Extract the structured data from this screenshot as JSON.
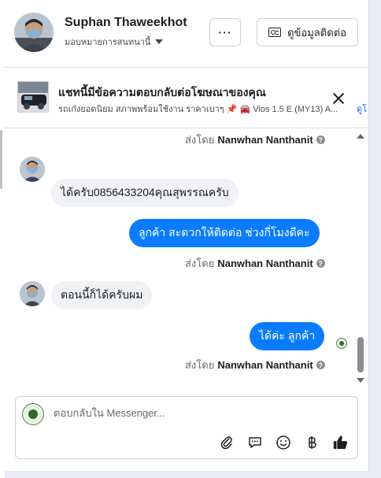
{
  "header": {
    "contact_name": "Suphan Thaweekhot",
    "assign_label": "มอบหมายการสนทนานี้",
    "more_label": "···",
    "contact_info_label": "ดูข้อมูลติดต่อ"
  },
  "ad": {
    "title": "แชทนี้มีข้อความตอบกลับต่อโฆษณาของคุณ",
    "subtitle": "รถเก๋งยอดนิยม สภาพพร้อมใช้งาน ราคาเบาๆ 📌 🚘 Vios 1.5 E (MY13) A...",
    "more_link": "ดูโ"
  },
  "messages": [
    {
      "type": "sent_by",
      "prefix": "ส่งโดย",
      "name": "Nanwhan Nanthanit"
    },
    {
      "type": "incoming",
      "text": "ได้ครับ0856433204คุณสุพรรณครับ"
    },
    {
      "type": "outgoing",
      "text": "ลูกค้า สะดวกให้ติดต่อ ช่วงกี่โมงดีคะ"
    },
    {
      "type": "sent_by",
      "prefix": "ส่งโดย",
      "name": "Nanwhan Nanthanit"
    },
    {
      "type": "incoming",
      "text": "ตอนนี้ก็ได้ครับผม"
    },
    {
      "type": "outgoing",
      "text": "ได้ค่ะ  ลูกค้า"
    },
    {
      "type": "sent_by",
      "prefix": "ส่งโดย",
      "name": "Nanwhan Nanthanit"
    }
  ],
  "composer": {
    "placeholder": "ตอบกลับใน Messenger..."
  },
  "icons": {
    "attach": "paperclip-icon",
    "quick_reply": "chat-bubble-icon",
    "emoji": "smiley-icon",
    "currency": "baht-icon",
    "like": "thumbs-up-icon"
  },
  "colors": {
    "outgoing_bubble": "#0a7cff",
    "incoming_bubble": "#f0f2f5",
    "link": "#0866ff",
    "like_icon": "#1c1e21"
  }
}
